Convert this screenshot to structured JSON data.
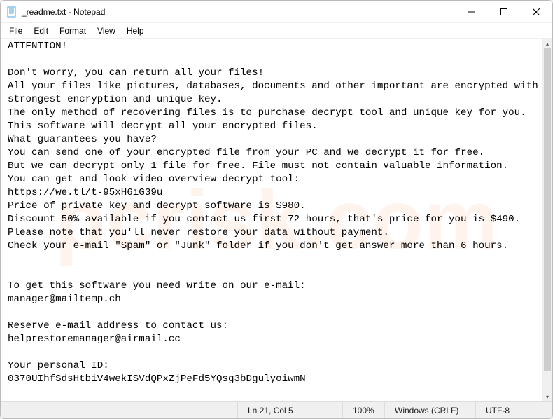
{
  "titlebar": {
    "title": "_readme.txt - Notepad"
  },
  "menubar": {
    "file": "File",
    "edit": "Edit",
    "format": "Format",
    "view": "View",
    "help": "Help"
  },
  "content": "ATTENTION!\n\nDon't worry, you can return all your files!\nAll your files like pictures, databases, documents and other important are encrypted with strongest encryption and unique key.\nThe only method of recovering files is to purchase decrypt tool and unique key for you.\nThis software will decrypt all your encrypted files.\nWhat guarantees you have?\nYou can send one of your encrypted file from your PC and we decrypt it for free.\nBut we can decrypt only 1 file for free. File must not contain valuable information.\nYou can get and look video overview decrypt tool:\nhttps://we.tl/t-95xH6iG39u\nPrice of private key and decrypt software is $980.\nDiscount 50% available if you contact us first 72 hours, that's price for you is $490.\nPlease note that you'll never restore your data without payment.\nCheck your e-mail \"Spam\" or \"Junk\" folder if you don't get answer more than 6 hours.\n\n\nTo get this software you need write on our e-mail:\nmanager@mailtemp.ch\n\nReserve e-mail address to contact us:\nhelprestoremanager@airmail.cc\n\nYour personal ID:\n0370UIhfSdsHtbiV4wekISVdQPxZjPeFd5YQsg3bDgulyoiwmN",
  "statusbar": {
    "position": "Ln 21, Col 5",
    "zoom": "100%",
    "line_ending": "Windows (CRLF)",
    "encoding": "UTF-8"
  },
  "watermark": "pcrisk.com"
}
